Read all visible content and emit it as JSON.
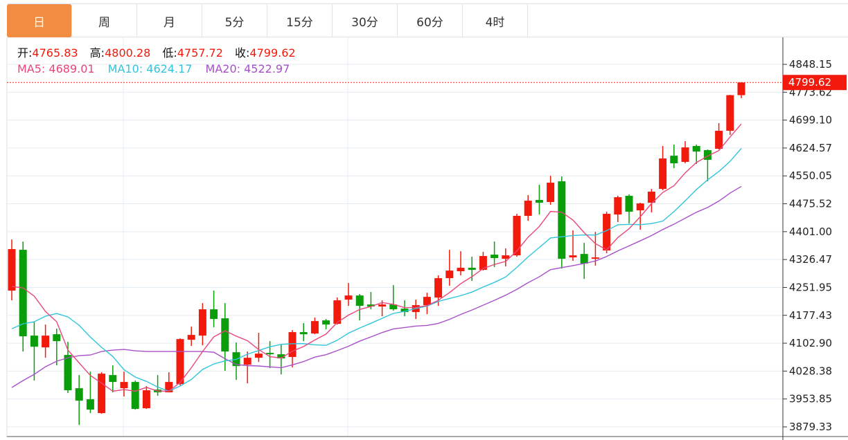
{
  "tabs": [
    {
      "label": "日",
      "active": true
    },
    {
      "label": "周"
    },
    {
      "label": "月"
    },
    {
      "label": "5分"
    },
    {
      "label": "15分"
    },
    {
      "label": "30分"
    },
    {
      "label": "60分"
    },
    {
      "label": "4时"
    }
  ],
  "info": {
    "open_label": "开:",
    "open": "4765.83",
    "high_label": "高:",
    "high": "4800.28",
    "low_label": "低:",
    "low": "4757.72",
    "close_label": "收:",
    "close": "4799.62",
    "ma5": "MA5: 4689.01",
    "ma10": "MA10: 4624.17",
    "ma20": "MA20: 4522.97"
  },
  "colors": {
    "up": "#f21a0c",
    "down": "#0a9e0a",
    "ma5": "#e9457a",
    "ma10": "#2fc5dc",
    "ma20": "#a84fc9",
    "accent": "#f28c42"
  },
  "chart_data": {
    "type": "candlestick",
    "ylim": [
      3879.33,
      4848.15
    ],
    "y_ticks": [
      "4848.15",
      "4773.62",
      "4699.10",
      "4624.57",
      "4550.05",
      "4475.52",
      "4401.00",
      "4326.47",
      "4251.95",
      "4177.43",
      "4102.90",
      "4028.38",
      "3953.85",
      "3879.33"
    ],
    "last_price": "4799.62",
    "grid": true,
    "ohlc": [
      [
        4243.4,
        4380.2,
        4217.5,
        4354.4
      ],
      [
        4352.5,
        4374.7,
        4080.7,
        4121.3
      ],
      [
        4123.2,
        4160.2,
        4003.0,
        4093.6
      ],
      [
        4091.8,
        4152.8,
        4064.0,
        4123.2
      ],
      [
        4126.9,
        4141.7,
        4043.7,
        4108.4
      ],
      [
        4071.4,
        4106.6,
        3969.7,
        3977.1
      ],
      [
        3982.6,
        4017.8,
        3884.6,
        3949.4
      ],
      [
        3953.1,
        4027.0,
        3916.1,
        3925.4
      ],
      [
        3916.1,
        4025.2,
        3914.3,
        4021.5
      ],
      [
        4017.8,
        4043.7,
        3971.6,
        3999.3
      ],
      [
        3982.6,
        4027.0,
        3960.5,
        3999.3
      ],
      [
        3999.3,
        4003.0,
        3925.4,
        3927.3
      ],
      [
        3929.1,
        3988.2,
        3927.3,
        3977.1
      ],
      [
        3978.9,
        4017.8,
        3962.3,
        3971.6
      ],
      [
        3971.6,
        4025.2,
        3971.6,
        3999.3
      ],
      [
        3993.7,
        4115.8,
        3990.1,
        4113.9
      ],
      [
        4112.1,
        4147.2,
        4095.5,
        4125.0
      ],
      [
        4123.2,
        4210.1,
        4097.3,
        4193.5
      ],
      [
        4193.5,
        4243.4,
        4145.4,
        4167.6
      ],
      [
        4169.4,
        4210.1,
        4028.9,
        4080.7
      ],
      [
        4078.8,
        4104.7,
        4004.8,
        4041.8
      ],
      [
        4045.5,
        4080.7,
        3995.6,
        4064.0
      ],
      [
        4064.0,
        4130.6,
        4052.9,
        4075.1
      ],
      [
        4077.0,
        4108.4,
        4036.3,
        4073.3
      ],
      [
        4073.3,
        4099.2,
        4019.6,
        4062.2
      ],
      [
        4066.0,
        4138.0,
        4038.1,
        4132.5
      ],
      [
        4132.5,
        4156.5,
        4108.4,
        4126.9
      ],
      [
        4128.8,
        4171.3,
        4126.9,
        4162.0
      ],
      [
        4163.9,
        4167.6,
        4139.9,
        4152.8
      ],
      [
        4154.6,
        4224.9,
        4152.8,
        4217.5
      ],
      [
        4219.3,
        4263.7,
        4202.7,
        4230.4
      ],
      [
        4230.4,
        4234.2,
        4163.9,
        4202.7
      ],
      [
        4206.4,
        4239.7,
        4193.5,
        4200.9
      ],
      [
        4200.9,
        4217.5,
        4175.0,
        4206.4
      ],
      [
        4206.4,
        4258.2,
        4189.8,
        4193.5
      ],
      [
        4195.3,
        4217.5,
        4175.0,
        4186.1
      ],
      [
        4186.1,
        4219.3,
        4167.6,
        4204.6
      ],
      [
        4204.6,
        4237.8,
        4180.5,
        4226.7
      ],
      [
        4224.9,
        4284.1,
        4202.7,
        4276.7
      ],
      [
        4276.7,
        4352.5,
        4256.4,
        4297.0
      ],
      [
        4295.2,
        4348.8,
        4284.1,
        4304.5
      ],
      [
        4304.5,
        4334.0,
        4269.3,
        4298.9
      ],
      [
        4298.9,
        4346.9,
        4297.0,
        4335.9
      ],
      [
        4339.6,
        4374.7,
        4306.3,
        4330.3
      ],
      [
        4328.5,
        4356.2,
        4308.2,
        4337.7
      ],
      [
        4337.7,
        4448.7,
        4334.0,
        4443.2
      ],
      [
        4443.2,
        4498.6,
        4430.2,
        4483.8
      ],
      [
        4485.7,
        4526.3,
        4446.8,
        4478.3
      ],
      [
        4480.1,
        4550.4,
        4472.7,
        4531.9
      ],
      [
        4535.6,
        4548.6,
        4302.6,
        4328.5
      ],
      [
        4332.2,
        4404.3,
        4322.9,
        4337.7
      ],
      [
        4341.4,
        4371.0,
        4274.8,
        4315.5
      ],
      [
        4328.5,
        4400.6,
        4310.0,
        4332.2
      ],
      [
        4350.7,
        4454.2,
        4343.3,
        4448.7
      ],
      [
        4446.8,
        4496.8,
        4426.5,
        4493.1
      ],
      [
        4496.8,
        4500.5,
        4422.8,
        4454.2
      ],
      [
        4457.9,
        4478.3,
        4406.1,
        4476.4
      ],
      [
        4478.3,
        4515.2,
        4452.4,
        4507.9
      ],
      [
        4515.2,
        4629.9,
        4511.6,
        4596.6
      ],
      [
        4604.0,
        4633.6,
        4570.7,
        4583.7
      ],
      [
        4587.4,
        4642.9,
        4583.7,
        4626.2
      ],
      [
        4629.9,
        4633.6,
        4581.9,
        4615.1
      ],
      [
        4618.8,
        4620.7,
        4535.6,
        4592.9
      ],
      [
        4622.5,
        4690.9,
        4620.7,
        4670.6
      ],
      [
        4670.6,
        4766.8,
        4659.5,
        4765.8
      ],
      [
        4765.83,
        4800.28,
        4757.72,
        4799.62
      ]
    ],
    "ma5_start": [
      4254.5,
      4250.8,
      4228.6,
      4187.9
    ],
    "ma10_start": [
      4141.7,
      4154.6,
      4160.2,
      4175.0,
      4182.4,
      4173.1,
      4150.9,
      4119.5,
      4091.8
    ],
    "ma20_start": [
      3984.5,
      4003.0,
      4019.6,
      4040.0,
      4054.8,
      4064.0,
      4069.6,
      4071.4,
      4080.7,
      4084.4,
      4086.2,
      4082.5,
      4080.7,
      4080.7,
      4080.7,
      4080.7,
      4080.7,
      4080.7,
      4078.8
    ]
  }
}
